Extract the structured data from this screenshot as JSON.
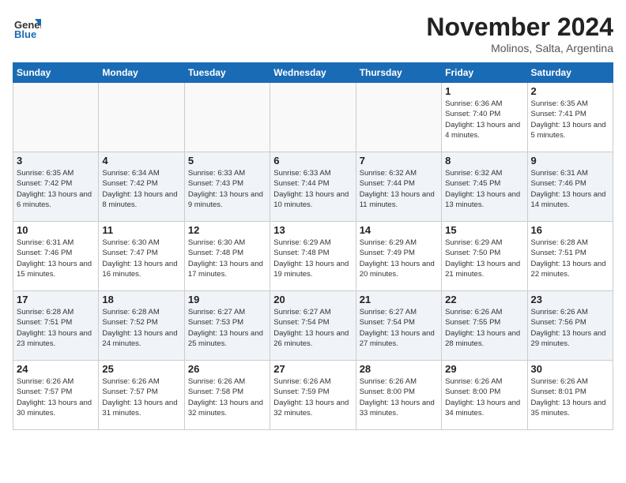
{
  "header": {
    "logo_general": "General",
    "logo_blue": "Blue",
    "month_title": "November 2024",
    "subtitle": "Molinos, Salta, Argentina"
  },
  "weekdays": [
    "Sunday",
    "Monday",
    "Tuesday",
    "Wednesday",
    "Thursday",
    "Friday",
    "Saturday"
  ],
  "weeks": [
    [
      {
        "day": "",
        "info": ""
      },
      {
        "day": "",
        "info": ""
      },
      {
        "day": "",
        "info": ""
      },
      {
        "day": "",
        "info": ""
      },
      {
        "day": "",
        "info": ""
      },
      {
        "day": "1",
        "info": "Sunrise: 6:36 AM\nSunset: 7:40 PM\nDaylight: 13 hours and 4 minutes."
      },
      {
        "day": "2",
        "info": "Sunrise: 6:35 AM\nSunset: 7:41 PM\nDaylight: 13 hours and 5 minutes."
      }
    ],
    [
      {
        "day": "3",
        "info": "Sunrise: 6:35 AM\nSunset: 7:42 PM\nDaylight: 13 hours and 6 minutes."
      },
      {
        "day": "4",
        "info": "Sunrise: 6:34 AM\nSunset: 7:42 PM\nDaylight: 13 hours and 8 minutes."
      },
      {
        "day": "5",
        "info": "Sunrise: 6:33 AM\nSunset: 7:43 PM\nDaylight: 13 hours and 9 minutes."
      },
      {
        "day": "6",
        "info": "Sunrise: 6:33 AM\nSunset: 7:44 PM\nDaylight: 13 hours and 10 minutes."
      },
      {
        "day": "7",
        "info": "Sunrise: 6:32 AM\nSunset: 7:44 PM\nDaylight: 13 hours and 11 minutes."
      },
      {
        "day": "8",
        "info": "Sunrise: 6:32 AM\nSunset: 7:45 PM\nDaylight: 13 hours and 13 minutes."
      },
      {
        "day": "9",
        "info": "Sunrise: 6:31 AM\nSunset: 7:46 PM\nDaylight: 13 hours and 14 minutes."
      }
    ],
    [
      {
        "day": "10",
        "info": "Sunrise: 6:31 AM\nSunset: 7:46 PM\nDaylight: 13 hours and 15 minutes."
      },
      {
        "day": "11",
        "info": "Sunrise: 6:30 AM\nSunset: 7:47 PM\nDaylight: 13 hours and 16 minutes."
      },
      {
        "day": "12",
        "info": "Sunrise: 6:30 AM\nSunset: 7:48 PM\nDaylight: 13 hours and 17 minutes."
      },
      {
        "day": "13",
        "info": "Sunrise: 6:29 AM\nSunset: 7:48 PM\nDaylight: 13 hours and 19 minutes."
      },
      {
        "day": "14",
        "info": "Sunrise: 6:29 AM\nSunset: 7:49 PM\nDaylight: 13 hours and 20 minutes."
      },
      {
        "day": "15",
        "info": "Sunrise: 6:29 AM\nSunset: 7:50 PM\nDaylight: 13 hours and 21 minutes."
      },
      {
        "day": "16",
        "info": "Sunrise: 6:28 AM\nSunset: 7:51 PM\nDaylight: 13 hours and 22 minutes."
      }
    ],
    [
      {
        "day": "17",
        "info": "Sunrise: 6:28 AM\nSunset: 7:51 PM\nDaylight: 13 hours and 23 minutes."
      },
      {
        "day": "18",
        "info": "Sunrise: 6:28 AM\nSunset: 7:52 PM\nDaylight: 13 hours and 24 minutes."
      },
      {
        "day": "19",
        "info": "Sunrise: 6:27 AM\nSunset: 7:53 PM\nDaylight: 13 hours and 25 minutes."
      },
      {
        "day": "20",
        "info": "Sunrise: 6:27 AM\nSunset: 7:54 PM\nDaylight: 13 hours and 26 minutes."
      },
      {
        "day": "21",
        "info": "Sunrise: 6:27 AM\nSunset: 7:54 PM\nDaylight: 13 hours and 27 minutes."
      },
      {
        "day": "22",
        "info": "Sunrise: 6:26 AM\nSunset: 7:55 PM\nDaylight: 13 hours and 28 minutes."
      },
      {
        "day": "23",
        "info": "Sunrise: 6:26 AM\nSunset: 7:56 PM\nDaylight: 13 hours and 29 minutes."
      }
    ],
    [
      {
        "day": "24",
        "info": "Sunrise: 6:26 AM\nSunset: 7:57 PM\nDaylight: 13 hours and 30 minutes."
      },
      {
        "day": "25",
        "info": "Sunrise: 6:26 AM\nSunset: 7:57 PM\nDaylight: 13 hours and 31 minutes."
      },
      {
        "day": "26",
        "info": "Sunrise: 6:26 AM\nSunset: 7:58 PM\nDaylight: 13 hours and 32 minutes."
      },
      {
        "day": "27",
        "info": "Sunrise: 6:26 AM\nSunset: 7:59 PM\nDaylight: 13 hours and 32 minutes."
      },
      {
        "day": "28",
        "info": "Sunrise: 6:26 AM\nSunset: 8:00 PM\nDaylight: 13 hours and 33 minutes."
      },
      {
        "day": "29",
        "info": "Sunrise: 6:26 AM\nSunset: 8:00 PM\nDaylight: 13 hours and 34 minutes."
      },
      {
        "day": "30",
        "info": "Sunrise: 6:26 AM\nSunset: 8:01 PM\nDaylight: 13 hours and 35 minutes."
      }
    ]
  ]
}
